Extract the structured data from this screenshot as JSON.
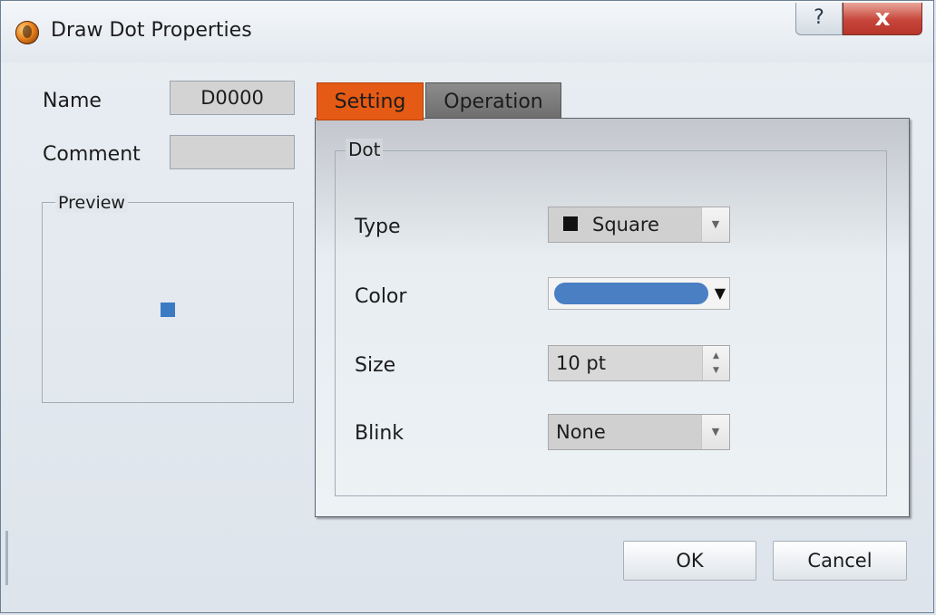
{
  "window": {
    "title": "Draw Dot Properties",
    "help_glyph": "?",
    "close_glyph": "x"
  },
  "left": {
    "name_label": "Name",
    "name_value": "D0000",
    "comment_label": "Comment",
    "comment_value": "",
    "preview_label": "Preview",
    "preview_dot_color": "#3d7ac4"
  },
  "tabs": [
    {
      "label": "Setting",
      "active": true
    },
    {
      "label": "Operation",
      "active": false
    }
  ],
  "dot_group": {
    "legend": "Dot",
    "type_label": "Type",
    "type_value": "Square",
    "color_label": "Color",
    "color_value": "#4a7fc4",
    "size_label": "Size",
    "size_value": "10 pt",
    "blink_label": "Blink",
    "blink_value": "None"
  },
  "buttons": {
    "ok": "OK",
    "cancel": "Cancel"
  },
  "colors": {
    "active_tab": "#e55a14",
    "inactive_tab": "#7d7d7d",
    "close_button": "#c7453a"
  }
}
